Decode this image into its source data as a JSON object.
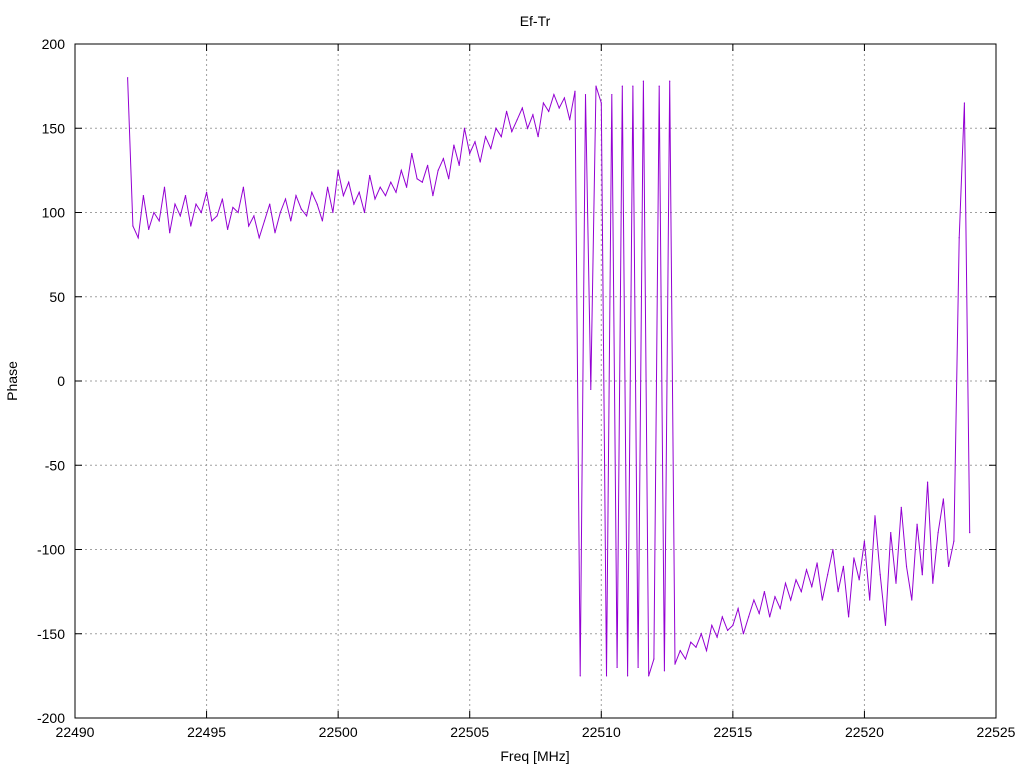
{
  "chart_data": {
    "type": "line",
    "title": "Ef-Tr",
    "xlabel": "Freq [MHz]",
    "ylabel": "Phase",
    "xlim": [
      22490,
      22525
    ],
    "ylim": [
      -200,
      200
    ],
    "xticks": [
      22490,
      22495,
      22500,
      22505,
      22510,
      22515,
      22520,
      22525
    ],
    "yticks": [
      -200,
      -150,
      -100,
      -50,
      0,
      50,
      100,
      150,
      200
    ],
    "grid": true,
    "legend": "none",
    "series": [
      {
        "name": "Ef-Tr phase",
        "color": "#9400D3",
        "x_start": 22492,
        "x_step": 0.2,
        "values": [
          180,
          92,
          85,
          110,
          90,
          100,
          95,
          115,
          88,
          105,
          98,
          110,
          92,
          105,
          100,
          112,
          95,
          98,
          108,
          90,
          103,
          100,
          115,
          92,
          98,
          85,
          95,
          105,
          88,
          100,
          108,
          95,
          110,
          102,
          98,
          112,
          105,
          95,
          115,
          100,
          125,
          110,
          118,
          105,
          112,
          100,
          122,
          108,
          115,
          110,
          118,
          112,
          125,
          115,
          135,
          120,
          118,
          128,
          110,
          125,
          132,
          120,
          140,
          128,
          150,
          135,
          142,
          130,
          145,
          138,
          150,
          145,
          160,
          148,
          155,
          162,
          150,
          158,
          145,
          165,
          160,
          170,
          162,
          168,
          155,
          172,
          -175,
          170,
          -5,
          175,
          165,
          -175,
          170,
          -170,
          175,
          -175,
          175,
          -170,
          178,
          -175,
          -165,
          175,
          -172,
          178,
          -168,
          -160,
          -165,
          -155,
          -158,
          -150,
          -160,
          -145,
          -152,
          -140,
          -148,
          -145,
          -135,
          -150,
          -140,
          -130,
          -138,
          -125,
          -140,
          -128,
          -135,
          -120,
          -130,
          -118,
          -125,
          -112,
          -122,
          -108,
          -130,
          -115,
          -100,
          -125,
          -110,
          -140,
          -105,
          -118,
          -95,
          -130,
          -80,
          -115,
          -145,
          -90,
          -120,
          -75,
          -110,
          -130,
          -85,
          -115,
          -60,
          -120,
          -90,
          -70,
          -110,
          -95,
          85,
          165,
          -90
        ]
      }
    ]
  }
}
